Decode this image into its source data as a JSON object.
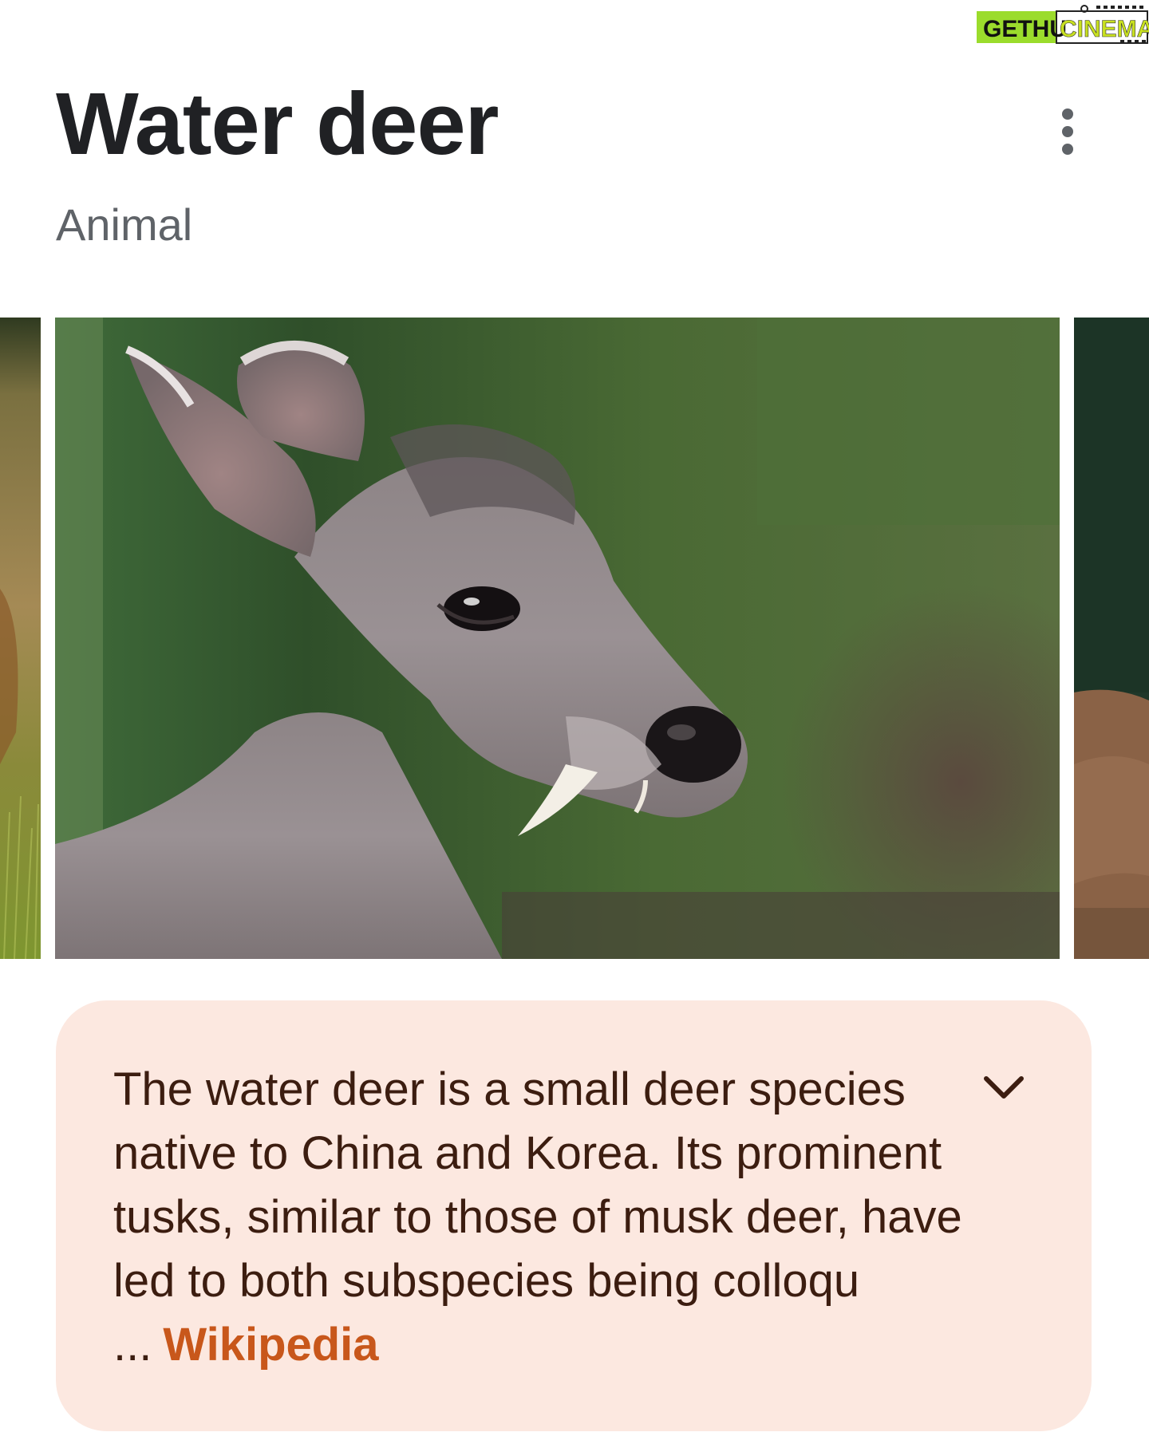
{
  "watermark": {
    "text_left": "GETHU",
    "text_right": "CINEMA"
  },
  "header": {
    "title": "Water deer",
    "subtitle": "Animal",
    "more_icon": "more-vert-icon"
  },
  "carousel": {
    "images": [
      {
        "description": "partial left image - grass and deer"
      },
      {
        "description": "water deer head with tusks"
      },
      {
        "description": "partial right image - brown deer"
      }
    ]
  },
  "description": {
    "text": "The water deer is a small deer species native to China and Korea. Its prominent tusks, similar to those of musk deer, have led to both subspecies being colloqu ...",
    "source": "Wikipedia",
    "expand_icon": "chevron-down-icon"
  },
  "colors": {
    "card_background": "#fce8e0",
    "card_text": "#3c1d10",
    "link": "#c8571b",
    "watermark_green": "#9bdc2c",
    "watermark_yellow": "#e8e62a"
  }
}
